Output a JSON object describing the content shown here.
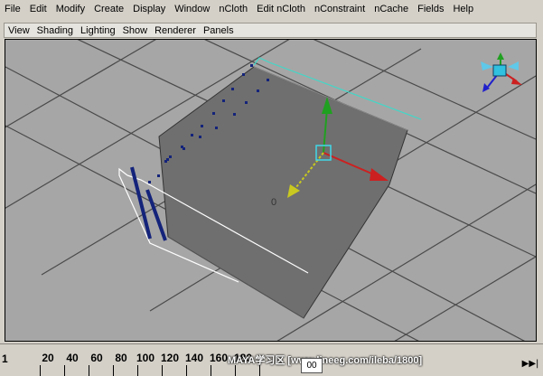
{
  "menubar": {
    "items": [
      "File",
      "Edit",
      "Modify",
      "Create",
      "Display",
      "Window",
      "nCloth",
      "Edit nCloth",
      "nConstraint",
      "nCache",
      "Fields",
      "Help"
    ]
  },
  "panel_menu": {
    "items": [
      "View",
      "Shading",
      "Lighting",
      "Show",
      "Renderer",
      "Panels"
    ]
  },
  "viewport": {
    "center_label": "0",
    "view_cube_icon": "view-axis-cube-icon",
    "manipulator_icon": "move-manipulator-icon",
    "colors": {
      "background": "#a6a6a6",
      "grid": "#4a4a4a",
      "object": "#6f6f6f",
      "edge_highlight": "#1a2a8a",
      "x_axis": "#cc2020",
      "y_axis": "#20a020",
      "z_axis": "#2020cc"
    }
  },
  "timeline": {
    "start_label": "1",
    "tick_labels": [
      "20",
      "40",
      "60",
      "80",
      "100",
      "120",
      "140",
      "160",
      "180"
    ],
    "current_frame": "00",
    "watermark": "MAYA学习区 [www.lineeg.com/ileba/1800]",
    "play_icon": "play-forward-icon"
  }
}
